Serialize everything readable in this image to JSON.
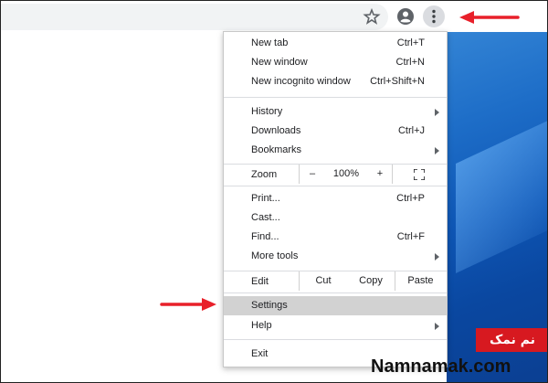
{
  "menu": {
    "items_group1": [
      {
        "label": "New tab",
        "shortcut": "Ctrl+T"
      },
      {
        "label": "New window",
        "shortcut": "Ctrl+N"
      },
      {
        "label": "New incognito window",
        "shortcut": "Ctrl+Shift+N"
      }
    ],
    "items_group2": [
      {
        "label": "History"
      },
      {
        "label": "Downloads",
        "shortcut": "Ctrl+J"
      },
      {
        "label": "Bookmarks"
      }
    ],
    "zoom": {
      "label": "Zoom",
      "minus": "–",
      "value": "100%",
      "plus": "+"
    },
    "items_group3": [
      {
        "label": "Print...",
        "shortcut": "Ctrl+P"
      },
      {
        "label": "Cast..."
      },
      {
        "label": "Find...",
        "shortcut": "Ctrl+F"
      },
      {
        "label": "More tools"
      }
    ],
    "edit": {
      "label": "Edit",
      "cut": "Cut",
      "copy": "Copy",
      "paste": "Paste"
    },
    "items_group4": [
      {
        "label": "Settings"
      },
      {
        "label": "Help"
      }
    ],
    "exit": {
      "label": "Exit"
    }
  },
  "watermark": {
    "badge": "نم نمک",
    "site": "Namnamak.com"
  },
  "colors": {
    "highlight": "#d2d2d2",
    "arrow": "#e8202a",
    "accent": "#3a7bd5"
  },
  "icons": [
    "star-icon",
    "account-icon",
    "more-vert-icon",
    "fullscreen-icon",
    "chevron-right-icon"
  ]
}
